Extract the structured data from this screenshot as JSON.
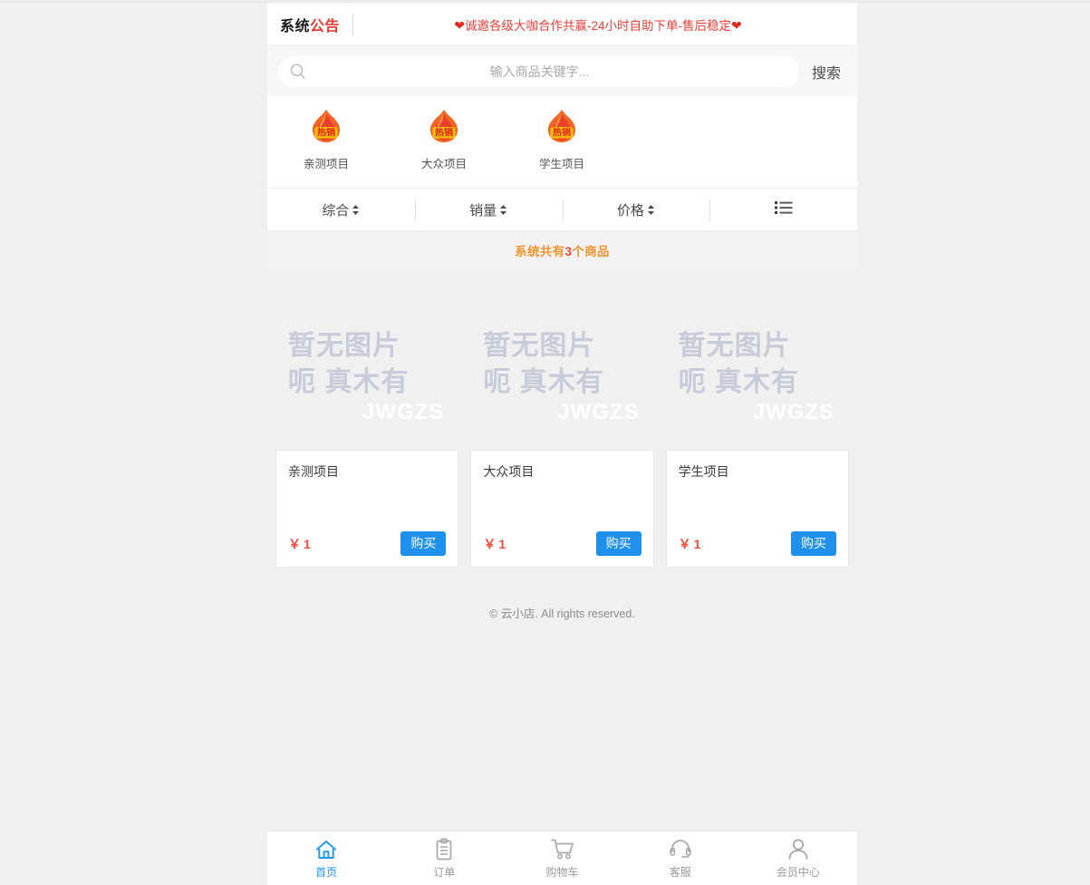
{
  "announcement": {
    "label_part1": "系统",
    "label_part2": "公告",
    "heart_left": "❤",
    "text": "诚邀各级大咖合作共赢-24小时自助下单-售后稳定",
    "heart_right": "❤"
  },
  "search": {
    "placeholder": "输入商品关键字...",
    "value": "",
    "button_label": "搜索",
    "icon": "search-icon"
  },
  "categories": [
    {
      "label": "亲测项目",
      "icon": "hot-sale-flame-icon",
      "badge_text": "热销"
    },
    {
      "label": "大众项目",
      "icon": "hot-sale-flame-icon",
      "badge_text": "热销"
    },
    {
      "label": "学生项目",
      "icon": "hot-sale-flame-icon",
      "badge_text": "热销"
    }
  ],
  "sortbar": {
    "items": [
      {
        "label": "综合",
        "icon": "sort-updown-icon"
      },
      {
        "label": "销量",
        "icon": "sort-updown-icon"
      },
      {
        "label": "价格",
        "icon": "sort-updown-icon"
      }
    ],
    "view_toggle_icon": "list-view-icon"
  },
  "count_band": {
    "prefix": "系统共有",
    "number": "3",
    "suffix": "个商品"
  },
  "products": [
    {
      "title": "亲测项目",
      "price_symbol": "￥",
      "price": "1",
      "buy_label": "购买",
      "placeholder_line1": "暂无图片",
      "placeholder_line2": "呃 真木有",
      "placeholder_line3": "JWGZS"
    },
    {
      "title": "大众项目",
      "price_symbol": "￥",
      "price": "1",
      "buy_label": "购买",
      "placeholder_line1": "暂无图片",
      "placeholder_line2": "呃 真木有",
      "placeholder_line3": "JWGZS"
    },
    {
      "title": "学生项目",
      "price_symbol": "￥",
      "price": "1",
      "buy_label": "购买",
      "placeholder_line1": "暂无图片",
      "placeholder_line2": "呃 真木有",
      "placeholder_line3": "JWGZS"
    }
  ],
  "footer": {
    "text": "© 云小店. All rights reserved."
  },
  "bottom_nav": {
    "items": [
      {
        "label": "首页",
        "icon": "home-icon",
        "active": true
      },
      {
        "label": "订单",
        "icon": "clipboard-icon",
        "active": false
      },
      {
        "label": "购物车",
        "icon": "shopping-cart-icon",
        "active": false
      },
      {
        "label": "客服",
        "icon": "headset-icon",
        "active": false
      },
      {
        "label": "会员中心",
        "icon": "user-icon",
        "active": false
      }
    ]
  },
  "colors": {
    "accent_blue": "#1f90ed",
    "price_red": "#ef4b3f",
    "announce_red": "#e8413a",
    "count_orange": "#f0952f",
    "page_bg": "#f0f0f0"
  }
}
